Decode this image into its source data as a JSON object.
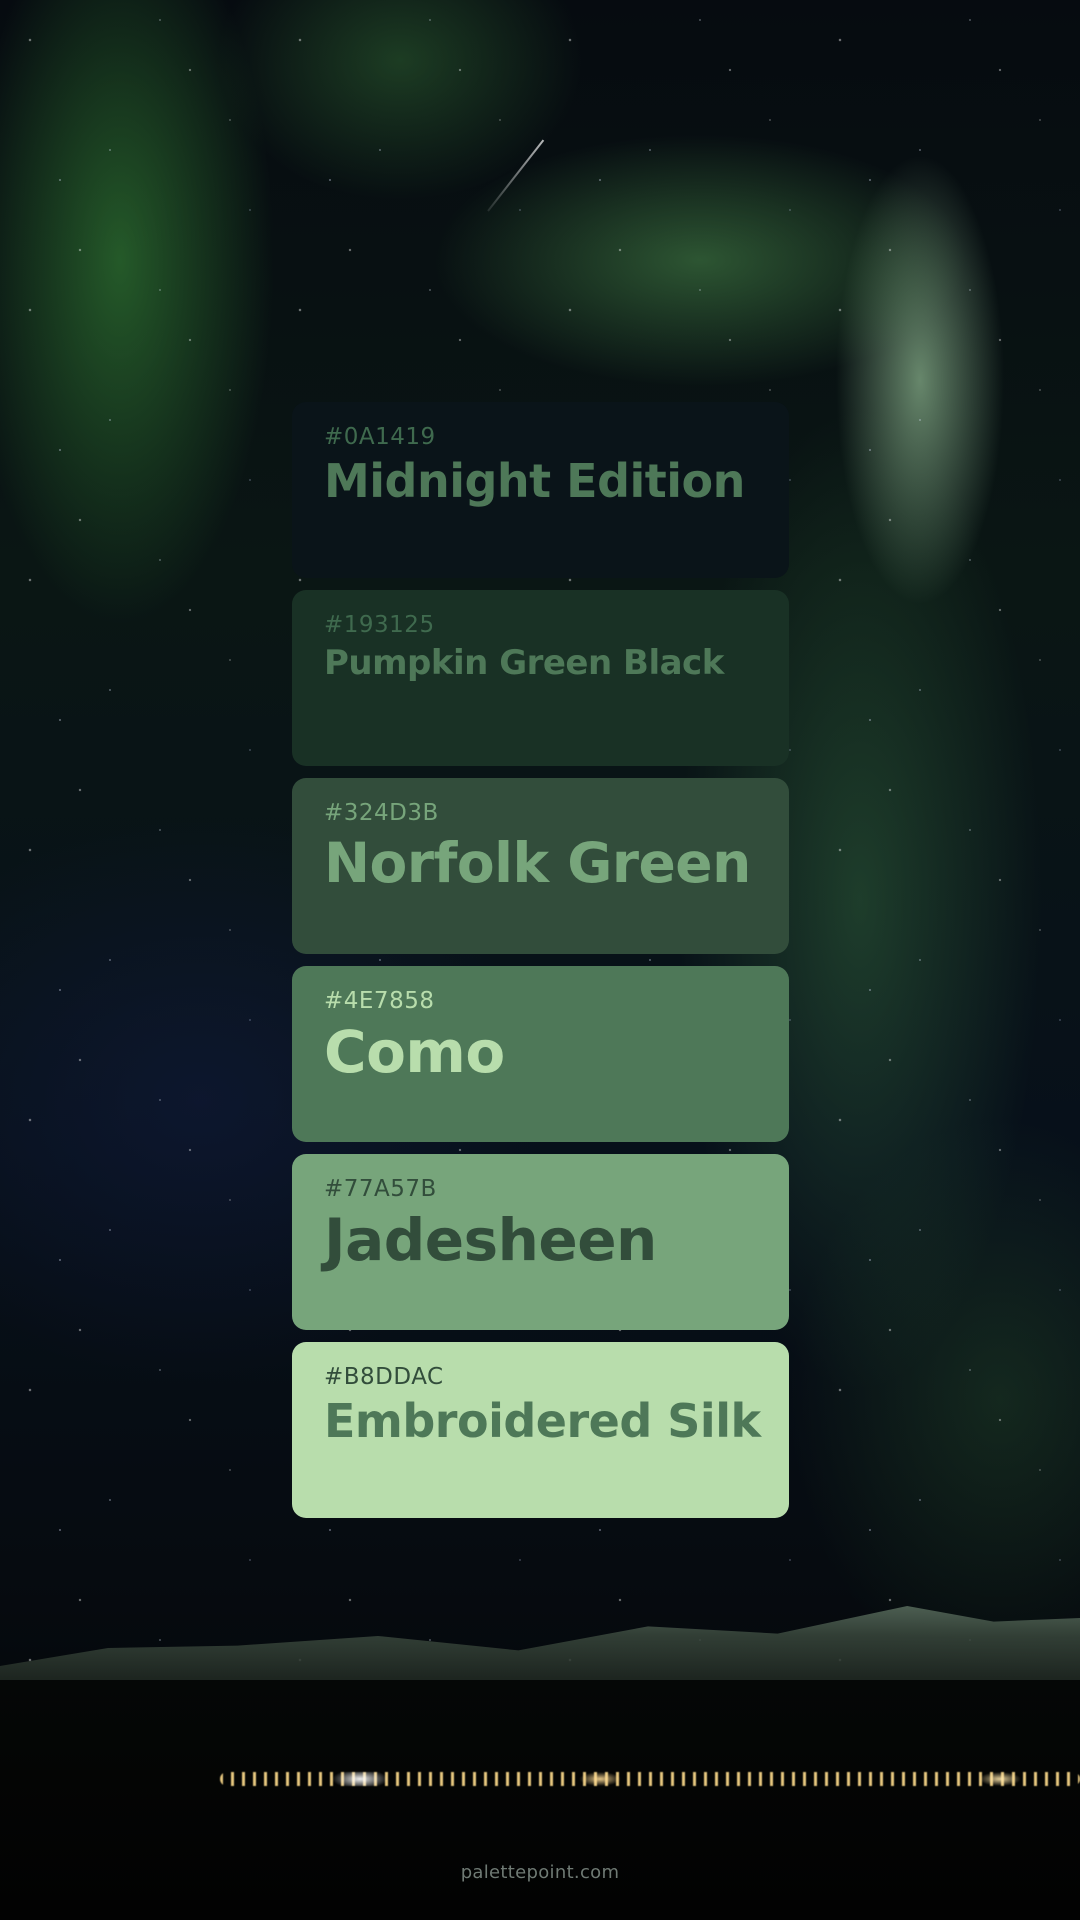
{
  "colors": [
    {
      "hex": "#0A1419",
      "name": "Midnight Edition"
    },
    {
      "hex": "#193125",
      "name": "Pumpkin Green Black"
    },
    {
      "hex": "#324D3B",
      "name": "Norfolk Green"
    },
    {
      "hex": "#4E7858",
      "name": "Como"
    },
    {
      "hex": "#77A57B",
      "name": "Jadesheen"
    },
    {
      "hex": "#B8DDAC",
      "name": "Embroidered Silk"
    }
  ],
  "footer": {
    "site": "palettepoint.com"
  }
}
